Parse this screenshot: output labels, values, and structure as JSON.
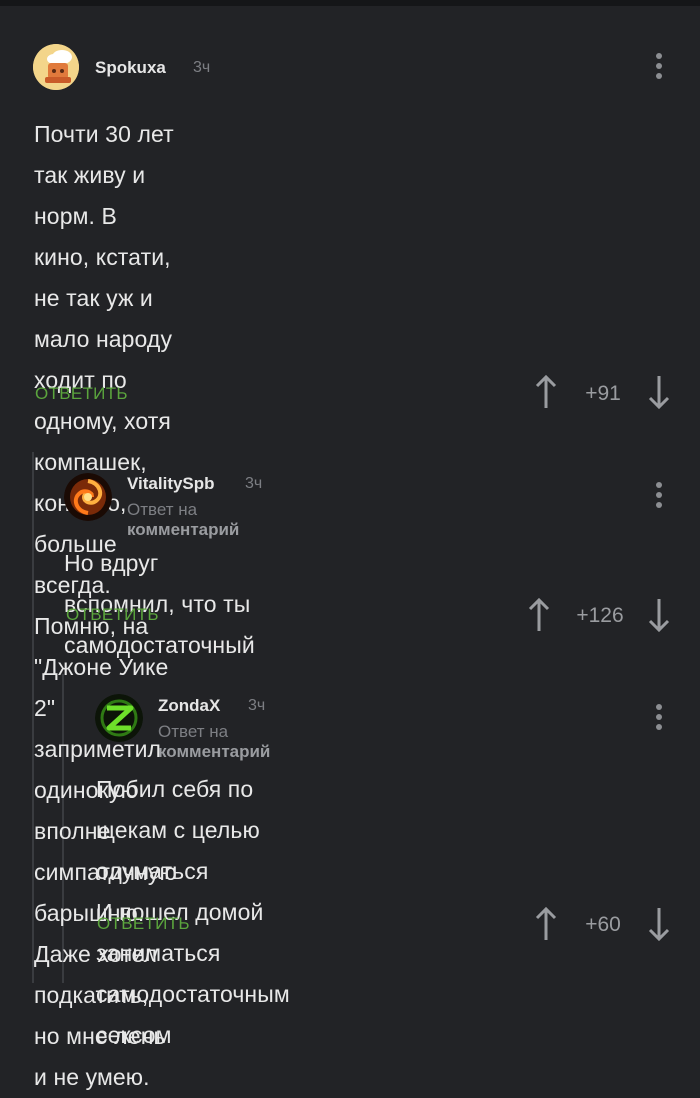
{
  "comments": [
    {
      "author": "Spokuxa",
      "time": "3ч",
      "reply_to": "",
      "text": [
        "Почти 30 лет так живу и норм. В кино, кстати,",
        "не так уж и мало народу ходит по одному, хотя",
        "компашек, конечно, больше всегда. Помню, на",
        "\"Джоне Уике 2\" заприметил одинокую вполне",
        "симпатичную барышню. Даже хотел подкатить,",
        "но мне лень и не умею."
      ],
      "reply_label": "ОТВЕТИТЬ",
      "rating": "+91",
      "avatar_icon": "chef-avatar-icon"
    },
    {
      "author": "VitalitySpb",
      "time": "3ч",
      "reply_to": {
        "prefix": "Ответ на",
        "target": "комментарий"
      },
      "text": [
        "Но вдруг вспомнил, что ты самодостаточный"
      ],
      "reply_label": "ОТВЕТИТЬ",
      "rating": "+126",
      "avatar_icon": "fire-swirl-avatar-icon"
    },
    {
      "author": "ZondaX",
      "time": "3ч",
      "reply_to": {
        "prefix": "Ответ на",
        "target": "комментарий"
      },
      "text": [
        "Побил себя по щекам с целью одуматься",
        "И пошел домой заниматься",
        "самодостаточным сексом"
      ],
      "reply_label": "ОТВЕТИТЬ",
      "rating": "+60",
      "avatar_icon": "green-z-avatar-icon"
    }
  ],
  "colors": {
    "background": "#222326",
    "accent_green": "#5ba53d",
    "muted": "#7d7f84"
  }
}
